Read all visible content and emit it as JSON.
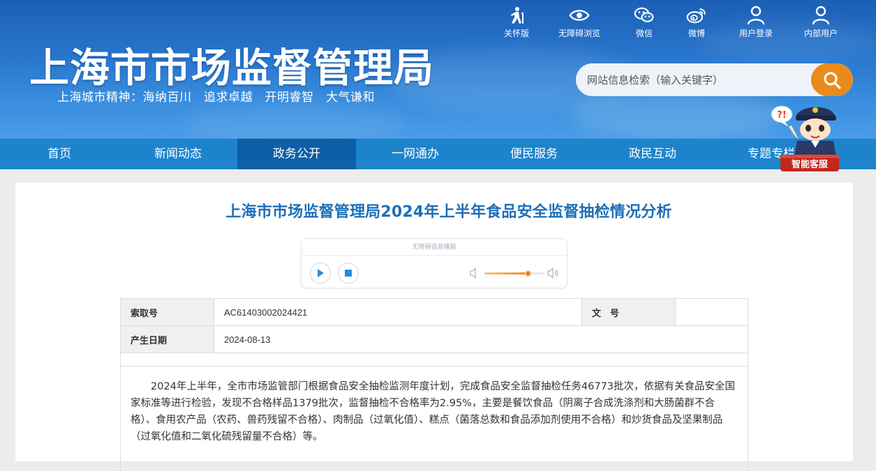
{
  "header": {
    "site_title": "上海市市场监督管理局",
    "city_spirit": "上海城市精神：海纳百川　追求卓越　开明睿智　大气谦和",
    "top_links": [
      {
        "label": "关怀版",
        "icon": "elderly-care-icon"
      },
      {
        "label": "无障碍浏览",
        "icon": "eye-icon"
      },
      {
        "label": "微信",
        "icon": "wechat-icon"
      },
      {
        "label": "微博",
        "icon": "weibo-icon"
      },
      {
        "label": "用户登录",
        "icon": "user-icon"
      },
      {
        "label": "内部用户",
        "icon": "user-icon"
      }
    ],
    "search": {
      "placeholder": "网站信息检索（输入关键字）",
      "icon": "search-icon"
    },
    "colors": {
      "header_blue": "#2a78cf",
      "search_orange": "#e88b1c"
    }
  },
  "nav": {
    "items": [
      "首页",
      "新闻动态",
      "政务公开",
      "一网通办",
      "便民服务",
      "政民互动",
      "专题专栏"
    ],
    "active_index": 2
  },
  "mascot": {
    "label": "智能客服",
    "bubble": "?!"
  },
  "article": {
    "title": "上海市市场监督管理局2024年上半年食品安全监督抽检情况分析",
    "player": {
      "title": "无障碍语音播报",
      "volume": 0.72
    },
    "meta": {
      "index_label": "索取号",
      "index_value": "AC61403002024421",
      "docno_label": "文　号",
      "docno_value": "",
      "date_label": "产生日期",
      "date_value": "2024-08-13"
    },
    "paragraph": "2024年上半年，全市市场监管部门根据食品安全抽检监测年度计划，完成食品安全监督抽检任务46773批次，依据有关食品安全国家标准等进行检验，发现不合格样品1379批次，监督抽检不合格率为2.95%，主要是餐饮食品（阴离子合成洗涤剂和大肠菌群不合格）、食用农产品（农药、兽药残留不合格）、肉制品（过氧化值）、糕点（菌落总数和食品添加剂使用不合格）和炒货食品及坚果制品（过氧化值和二氧化硫残留量不合格）等。"
  }
}
